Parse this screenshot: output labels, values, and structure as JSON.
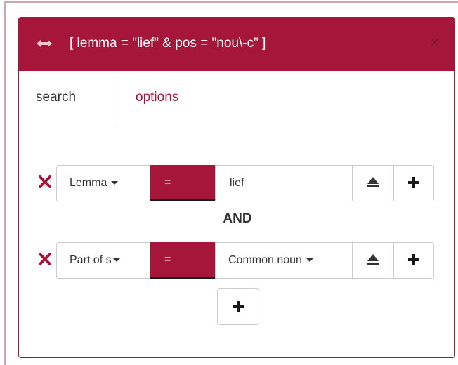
{
  "dialog": {
    "title": "[ lemma = \"lief\" & pos = \"nou\\-c\" ]",
    "close_label": "×",
    "drag_icon": "resize-horizontal-icon",
    "accent_color": "#a6163a"
  },
  "tabs": [
    {
      "label": "search",
      "active": true
    },
    {
      "label": "options",
      "active": false
    }
  ],
  "rules": [
    {
      "field": "Lemma",
      "operator": "=",
      "value": "lief",
      "value_is_dropdown": false
    },
    {
      "field": "Part of s",
      "operator": "=",
      "value": "Common noun",
      "value_is_dropdown": true
    }
  ],
  "connector": "AND",
  "icons": {
    "remove": "remove-x-icon",
    "upload": "eject-icon",
    "add": "plus-icon"
  }
}
